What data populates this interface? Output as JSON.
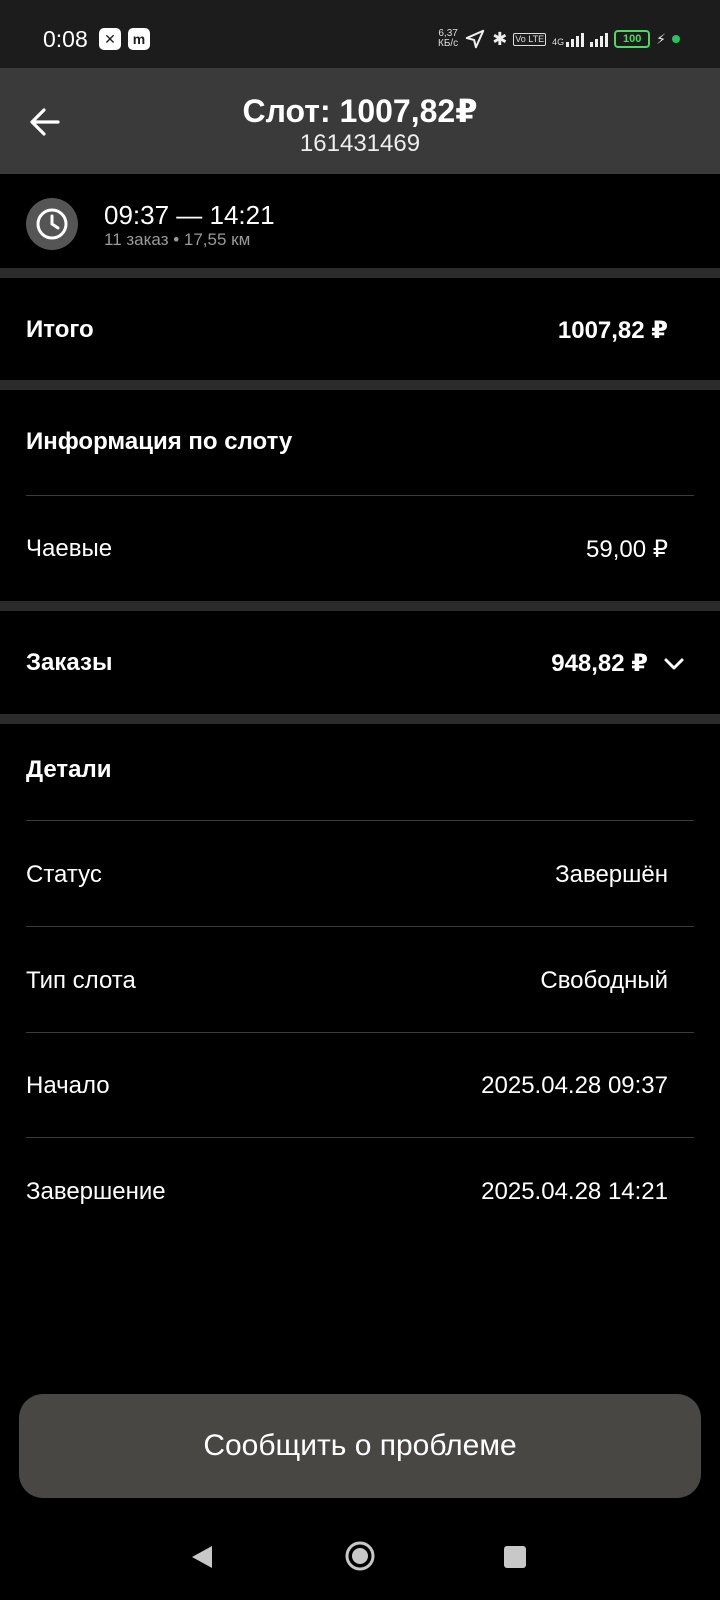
{
  "status_bar": {
    "time": "0:08",
    "net_speed_value": "6,37",
    "net_speed_unit": "КБ/с",
    "volte": "Vo LTE",
    "network": "4G",
    "battery": "100",
    "icons": [
      "app-x-icon",
      "app-m-icon",
      "location-arrow-icon",
      "bluetooth-icon",
      "signal-icon",
      "battery-icon",
      "charging-icon"
    ]
  },
  "header": {
    "title": "Слот: 1007,82₽",
    "subtitle": "161431469"
  },
  "slot": {
    "time_range": "09:37 — 14:21",
    "meta": "11 заказ • 17,55 км"
  },
  "total": {
    "label": "Итого",
    "value": "1007,82 ₽"
  },
  "slot_info": {
    "heading": "Информация по слоту",
    "tips_label": "Чаевые",
    "tips_value": "59,00 ₽"
  },
  "orders": {
    "label": "Заказы",
    "value": "948,82 ₽"
  },
  "details": {
    "heading": "Детали",
    "rows": [
      {
        "label": "Статус",
        "value": "Завершён"
      },
      {
        "label": "Тип слота",
        "value": "Свободный"
      },
      {
        "label": "Начало",
        "value": "2025.04.28 09:37"
      },
      {
        "label": "Завершение",
        "value": "2025.04.28 14:21"
      }
    ]
  },
  "actions": {
    "report_problem": "Сообщить о проблеме"
  },
  "colors": {
    "background": "#000000",
    "app_bar": "#3a3a3a",
    "button": "#484744",
    "battery": "#4cd964"
  }
}
